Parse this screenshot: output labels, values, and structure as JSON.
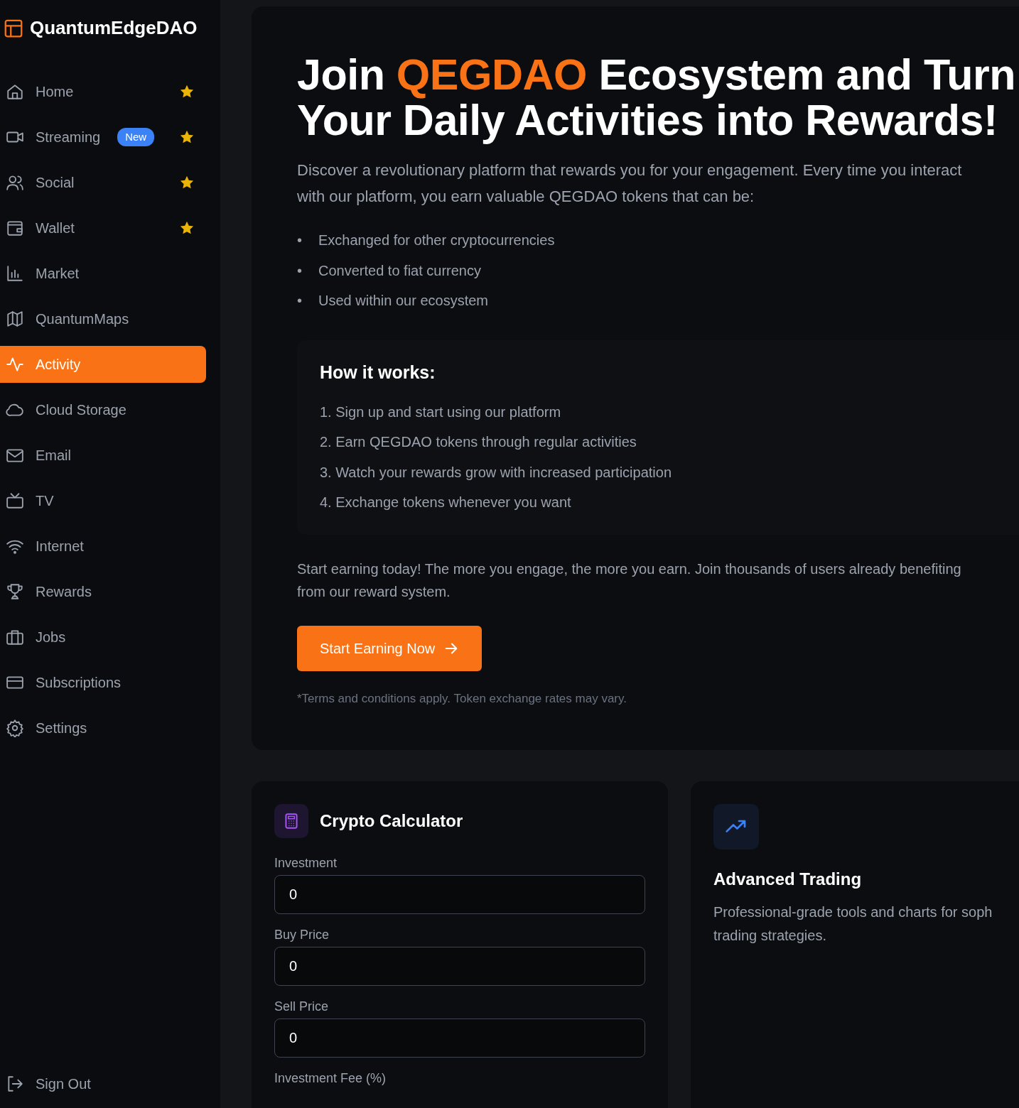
{
  "sidebar": {
    "brand": "QuantumEdgeDAO",
    "items": [
      {
        "kind": "home",
        "label": "Home",
        "selected": false,
        "starred": true
      },
      {
        "kind": "video",
        "label": "Streaming",
        "badge": "New",
        "selected": false,
        "starred": true
      },
      {
        "kind": "users",
        "label": "Social",
        "selected": false,
        "starred": true
      },
      {
        "kind": "wallet",
        "label": "Wallet",
        "selected": false,
        "starred": true
      },
      {
        "kind": "chart",
        "label": "Market",
        "selected": false,
        "starred": false
      },
      {
        "kind": "map",
        "label": "QuantumMaps",
        "selected": false,
        "starred": false
      },
      {
        "kind": "activity",
        "label": "Activity",
        "selected": true,
        "starred": false
      },
      {
        "kind": "cloud",
        "label": "Cloud Storage",
        "selected": false,
        "starred": false
      },
      {
        "kind": "mail",
        "label": "Email",
        "selected": false,
        "starred": false
      },
      {
        "kind": "tv",
        "label": "TV",
        "selected": false,
        "starred": false
      },
      {
        "kind": "wifi",
        "label": "Internet",
        "selected": false,
        "starred": false
      },
      {
        "kind": "trophy",
        "label": "Rewards",
        "selected": false,
        "starred": false
      },
      {
        "kind": "briefcase",
        "label": "Jobs",
        "selected": false,
        "starred": false
      },
      {
        "kind": "card",
        "label": "Subscriptions",
        "selected": false,
        "starred": false
      },
      {
        "kind": "gear",
        "label": "Settings",
        "selected": false,
        "starred": false
      }
    ],
    "sign_out": "Sign Out"
  },
  "hero": {
    "title_lines": [
      "Join **QEGDAO** Ecosystem and Turn",
      "Your Daily Activities into Rewards!"
    ],
    "intro": "Discover a revolutionary platform that rewards you for your engagement. Every time you interact with our platform, you earn valuable QEGDAO tokens that can be:",
    "bullets": [
      {
        "marker": "•",
        "text": "Exchanged for other cryptocurrencies"
      },
      {
        "marker": "•",
        "text": "Converted to fiat currency"
      },
      {
        "marker": "•",
        "text": "Used within our ecosystem"
      }
    ],
    "how_it_works": {
      "title": "How it works:",
      "steps": [
        "1. Sign up and start using our platform",
        "2. Earn QEGDAO tokens through regular activities",
        "3. Watch your rewards grow with increased participation",
        "4. Exchange tokens whenever you want"
      ]
    },
    "cta_lines": [
      "Start earning today! The more you engage, the more you earn. Join thousands of users already benefiting",
      "from our reward system."
    ],
    "button": "Start Earning Now",
    "disclaimer": "*Terms and conditions apply. Token exchange rates may vary."
  },
  "calculator": {
    "title": "Crypto Calculator",
    "fields": [
      {
        "label": "Investment",
        "value": "0"
      },
      {
        "label": "Buy Price",
        "value": "0"
      },
      {
        "label": "Sell Price",
        "value": "0"
      }
    ],
    "next_label": "Investment Fee (%)"
  },
  "trading": {
    "title": "Advanced Trading",
    "description_lines": [
      "Professional-grade tools and charts for soph",
      "trading strategies."
    ]
  }
}
